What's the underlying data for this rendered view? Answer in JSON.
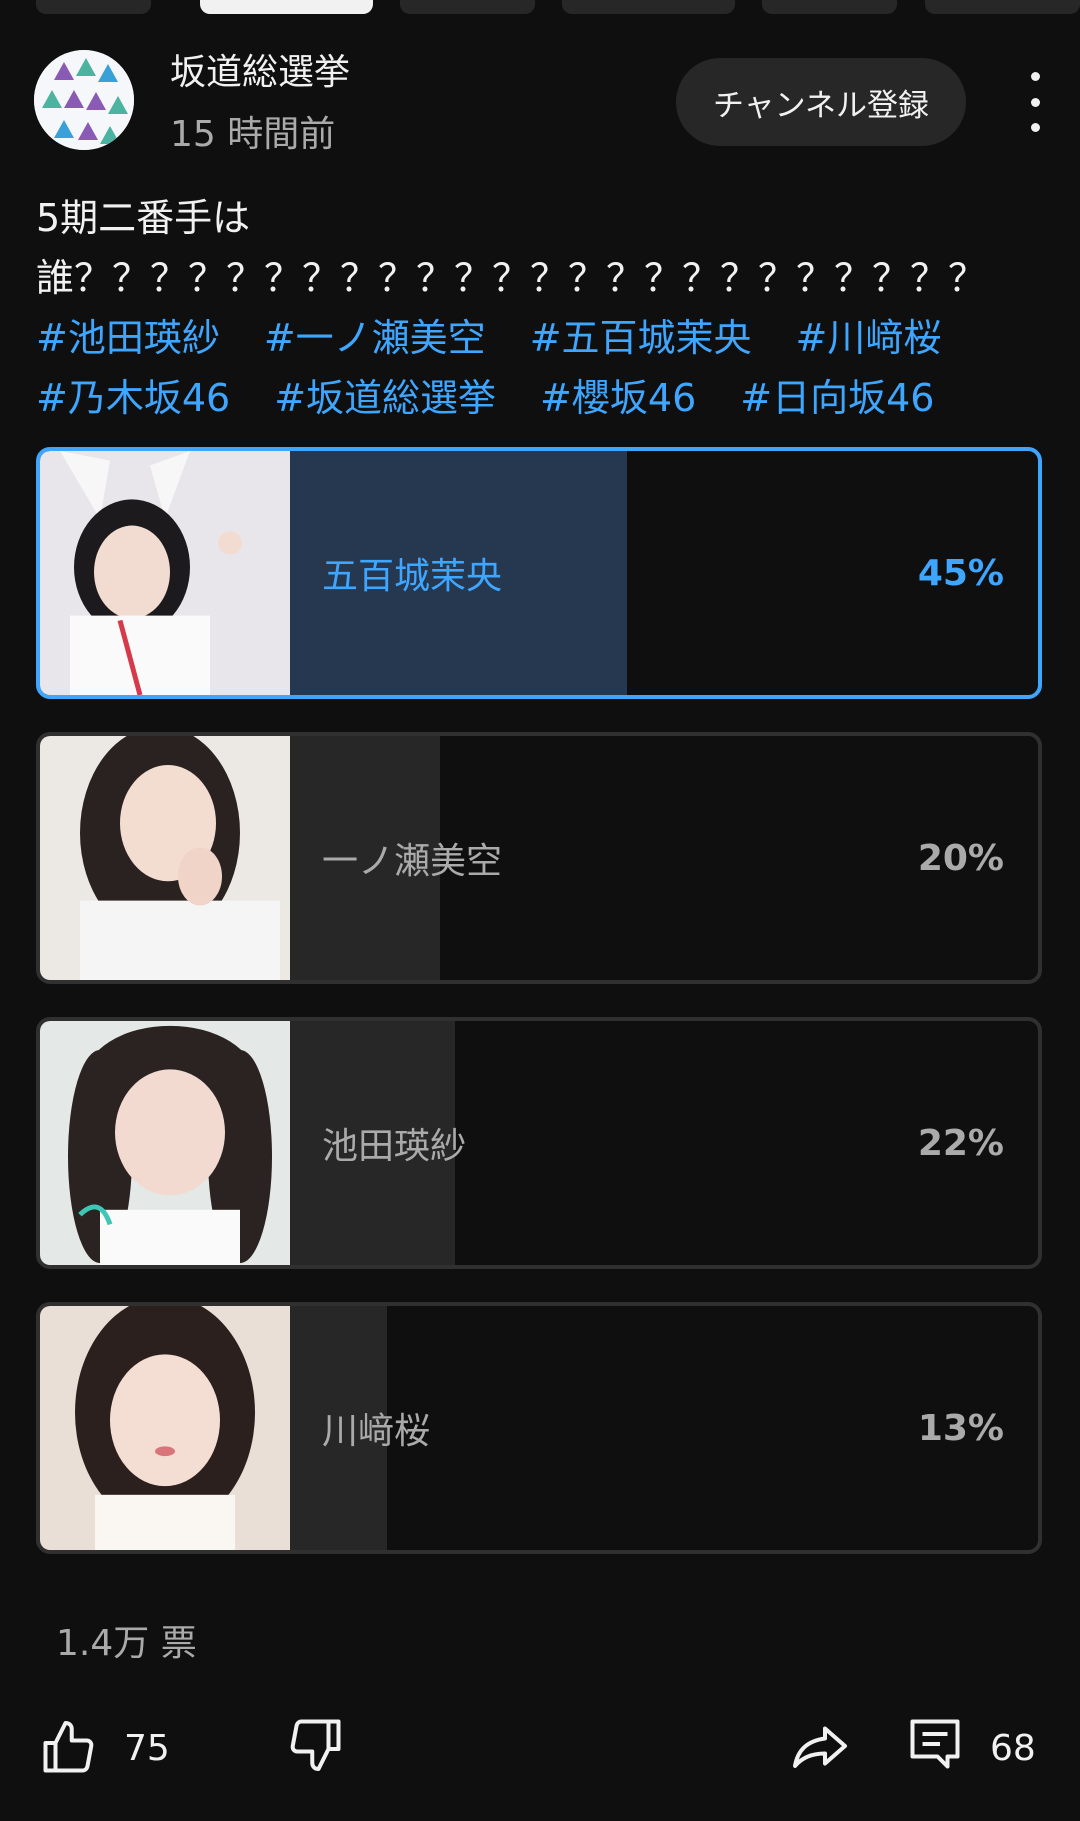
{
  "post": {
    "channel_name": "坂道総選挙",
    "time_ago": "15 時間前",
    "subscribe_label": "チャンネル登録",
    "text_line1": "5期二番手は",
    "text_line2": "誰？？？？？？？？？？？？？？？？？？？？？？？？",
    "hashtags_row1": [
      "#池田瑛紗",
      "#一ノ瀬美空",
      "#五百城茉央",
      "#川﨑桜"
    ],
    "hashtags_row2": [
      "#乃木坂46",
      "#坂道総選挙",
      "#櫻坂46",
      "#日向坂46"
    ]
  },
  "poll": {
    "options": [
      {
        "name": "五百城茉央",
        "percent_label": "45%",
        "percent": 45,
        "selected": true
      },
      {
        "name": "一ノ瀬美空",
        "percent_label": "20%",
        "percent": 20,
        "selected": false
      },
      {
        "name": "池田瑛紗",
        "percent_label": "22%",
        "percent": 22,
        "selected": false
      },
      {
        "name": "川﨑桜",
        "percent_label": "13%",
        "percent": 13,
        "selected": false
      }
    ],
    "votes_label": "1.4万 票"
  },
  "actions": {
    "like_count": "75",
    "comment_count": "68"
  },
  "colors": {
    "background": "#0f0f0f",
    "accent": "#3ea6ff",
    "selected_fill": "#263850",
    "fill": "#272727"
  },
  "icons": {
    "like": "thumbs-up-icon",
    "dislike": "thumbs-down-icon",
    "share": "share-arrow-icon",
    "comment": "comment-icon",
    "menu": "more-vertical-icon"
  }
}
